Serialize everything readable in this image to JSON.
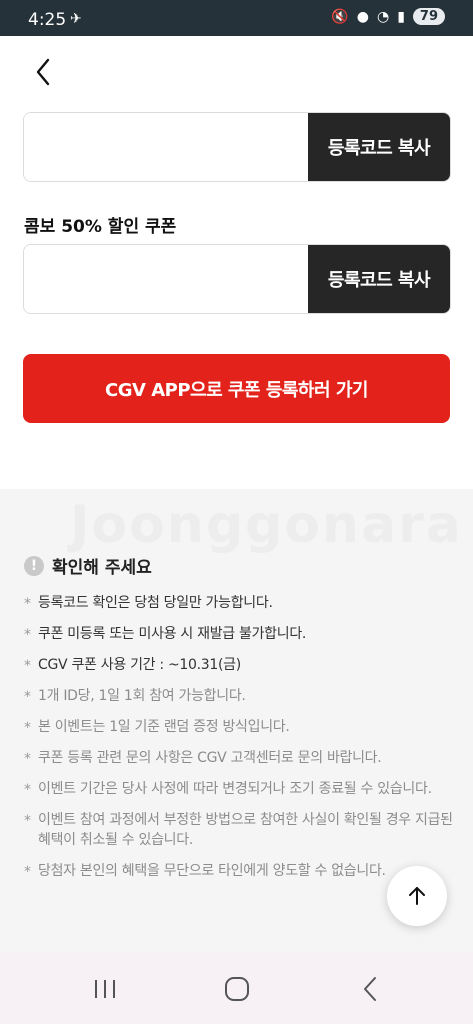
{
  "status_bar": {
    "time": "4:25",
    "battery": "79"
  },
  "coupons": [
    {
      "label": "",
      "code_value": "",
      "copy_label": "등록코드 복사"
    },
    {
      "label": "콤보 50% 할인 쿠폰",
      "code_value": "",
      "copy_label": "등록코드 복사"
    }
  ],
  "cta_label": "CGV APP으로 쿠폰 등록하러 가기",
  "watermark": "Joonggonara",
  "notice": {
    "title": "확인해 주세요",
    "items": [
      "등록코드 확인은 당첨 당일만 가능합니다.",
      "쿠폰 미등록 또는 미사용 시 재발급 불가합니다.",
      "CGV 쿠폰 사용 기간 : ~10.31(금)",
      "1개 ID당, 1일 1회 참여 가능합니다.",
      "본 이벤트는 1일 기준 랜덤 증정 방식입니다.",
      "쿠폰 등록 관련 문의 사항은 CGV 고객센터로 문의 바랍니다.",
      "이벤트 기간은 당사 사정에 따라 변경되거나 조기 종료될 수 있습니다.",
      "이벤트 참여 과정에서 부정한 방법으로 참여한 사실이 확인될 경우 지급된 혜택이 취소될 수 있습니다.",
      "당첨자 본인의 혜택을 무단으로 타인에게 양도할 수 없습니다."
    ]
  },
  "colors": {
    "cta": "#e3221b",
    "copy_button": "#262626",
    "status_bar": "#26323a"
  }
}
